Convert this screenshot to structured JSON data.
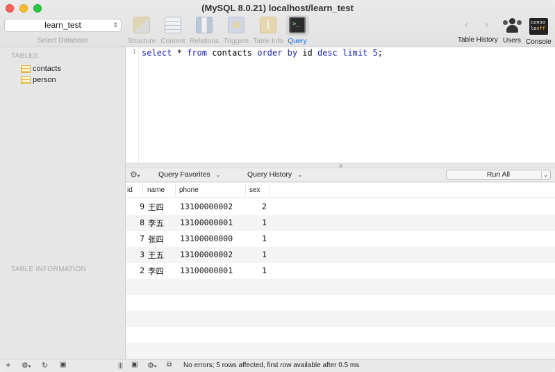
{
  "window": {
    "title": "(MySQL 8.0.21) localhost/learn_test"
  },
  "toolbar": {
    "database": "learn_test",
    "database_caption": "Select Database",
    "tools": [
      {
        "label": "Structure",
        "icon": "structure-icon"
      },
      {
        "label": "Content",
        "icon": "content-icon"
      },
      {
        "label": "Relations",
        "icon": "relations-icon"
      },
      {
        "label": "Triggers",
        "icon": "triggers-icon"
      },
      {
        "label": "Table Info",
        "icon": "table-info-icon",
        "glyph": "i"
      },
      {
        "label": "Query",
        "icon": "query-icon",
        "active": true
      }
    ],
    "right": {
      "back": "‹",
      "forward": "›",
      "history_label": "Table History",
      "users_label": "Users",
      "console_label": "Console",
      "console_glyph_top": "conso",
      "console_glyph_mid": "le",
      "console_glyph_off": "off"
    }
  },
  "sidebar": {
    "tables_header": "TABLES",
    "tables": [
      "contacts",
      "person"
    ],
    "info_header": "TABLE INFORMATION"
  },
  "editor": {
    "line_number": "1",
    "query": "select * from contacts order by id desc limit 5;"
  },
  "query_bar": {
    "gear": "⚙",
    "favorites": "Query Favorites",
    "history": "Query History",
    "run": "Run All"
  },
  "results": {
    "columns": [
      "id",
      "name",
      "phone",
      "sex"
    ],
    "rows": [
      [
        "9",
        "王四",
        "13100000002",
        "2"
      ],
      [
        "8",
        "李五",
        "13100000001",
        "1"
      ],
      [
        "7",
        "张四",
        "13100000000",
        "1"
      ],
      [
        "3",
        "王五",
        "13100000002",
        "1"
      ],
      [
        "2",
        "李四",
        "13100000001",
        "1"
      ]
    ]
  },
  "bottom_bar": {
    "add": "+",
    "gear": "⚙",
    "refresh": "↻",
    "filter": "▣",
    "columns": "|||",
    "status": "No errors; 5 rows affected, first row available after 0.5 ms"
  },
  "colors": {
    "accent": "#1e6fe0",
    "keyword": "#1a22d6"
  }
}
